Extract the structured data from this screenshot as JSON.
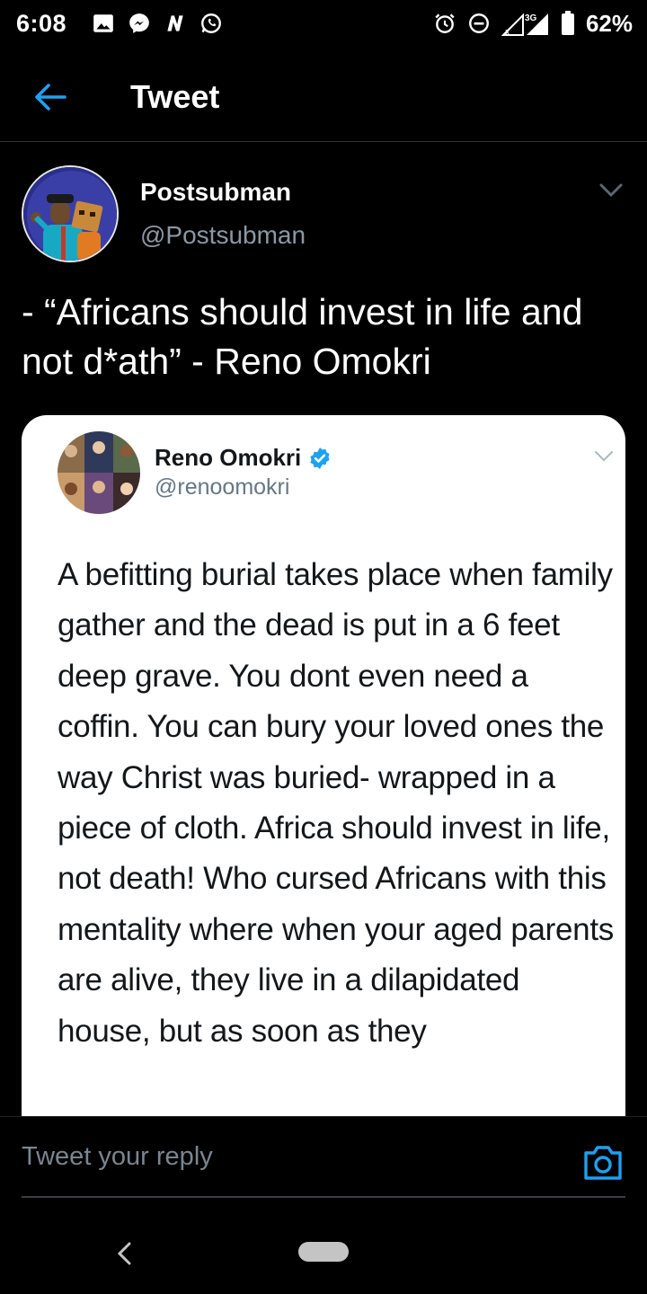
{
  "status_bar": {
    "time": "6:08",
    "network": "3G",
    "battery": "62%",
    "left_icons": [
      "image-icon",
      "messenger-icon",
      "n-app-icon",
      "whatsapp-icon"
    ],
    "right_icons": [
      "alarm-icon",
      "do-not-disturb-icon",
      "signal-icon",
      "battery-icon"
    ]
  },
  "header": {
    "title": "Tweet",
    "back_icon": "arrow-left-icon",
    "accent_color": "#1da1f2"
  },
  "tweet": {
    "author_name": "Postsubman",
    "author_handle": "@Postsubman",
    "text": "- “Africans should invest in life and not d*ath” - Reno Omokri"
  },
  "embedded": {
    "author_name": "Reno Omokri",
    "author_handle": "@renoomokri",
    "verified": true,
    "body": "A befitting burial takes place when family gather and the dead is put in a 6 feet deep grave. You dont even need a coffin. You can bury your loved ones the way Christ was buried- wrapped in a piece of cloth. Africa should invest in life, not death! Who cursed Africans with this mentality where when your aged parents are alive, they live in a dilapidated house, but as soon as they"
  },
  "reply": {
    "placeholder": "Tweet your reply",
    "camera_icon": "camera-icon"
  },
  "nav": {
    "back_icon": "chevron-left-icon",
    "home_icon": "home-pill-icon"
  }
}
